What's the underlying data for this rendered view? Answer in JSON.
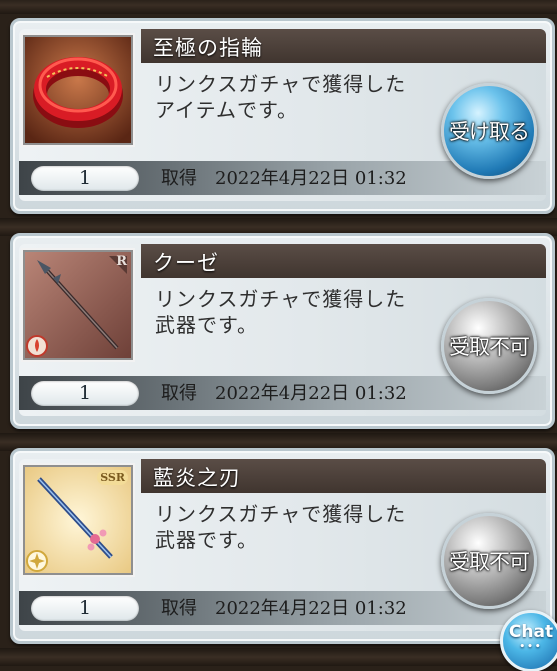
{
  "items": [
    {
      "title": "至極の指輪",
      "description_line1": "リンクスガチャで獲得した",
      "description_line2": "アイテムです。",
      "quantity": "1",
      "acquired_label": "取得",
      "acquired_date": "2022年4月22日 01:32",
      "button_label": "受け取る",
      "button_state": "active",
      "thumbnail": "ring-icon"
    },
    {
      "title": "クーゼ",
      "description_line1": "リンクスガチャで獲得した",
      "description_line2": "武器です。",
      "quantity": "1",
      "acquired_label": "取得",
      "acquired_date": "2022年4月22日 01:32",
      "button_label": "受取不可",
      "button_state": "disabled",
      "thumbnail": "spear-weapon-icon",
      "rarity": "R"
    },
    {
      "title": "藍炎之刃",
      "description_line1": "リンクスガチャで獲得した",
      "description_line2": "武器です。",
      "quantity": "1",
      "acquired_label": "取得",
      "acquired_date": "2022年4月22日 01:32",
      "button_label": "受取不可",
      "button_state": "disabled",
      "thumbnail": "sword-weapon-icon",
      "rarity": "SSR"
    }
  ],
  "chat_button": {
    "label": "Chat"
  },
  "colors": {
    "accept_button": "#1f79b5",
    "disabled_button": "#7c7c7c",
    "title_bar": "#4a3e38"
  }
}
